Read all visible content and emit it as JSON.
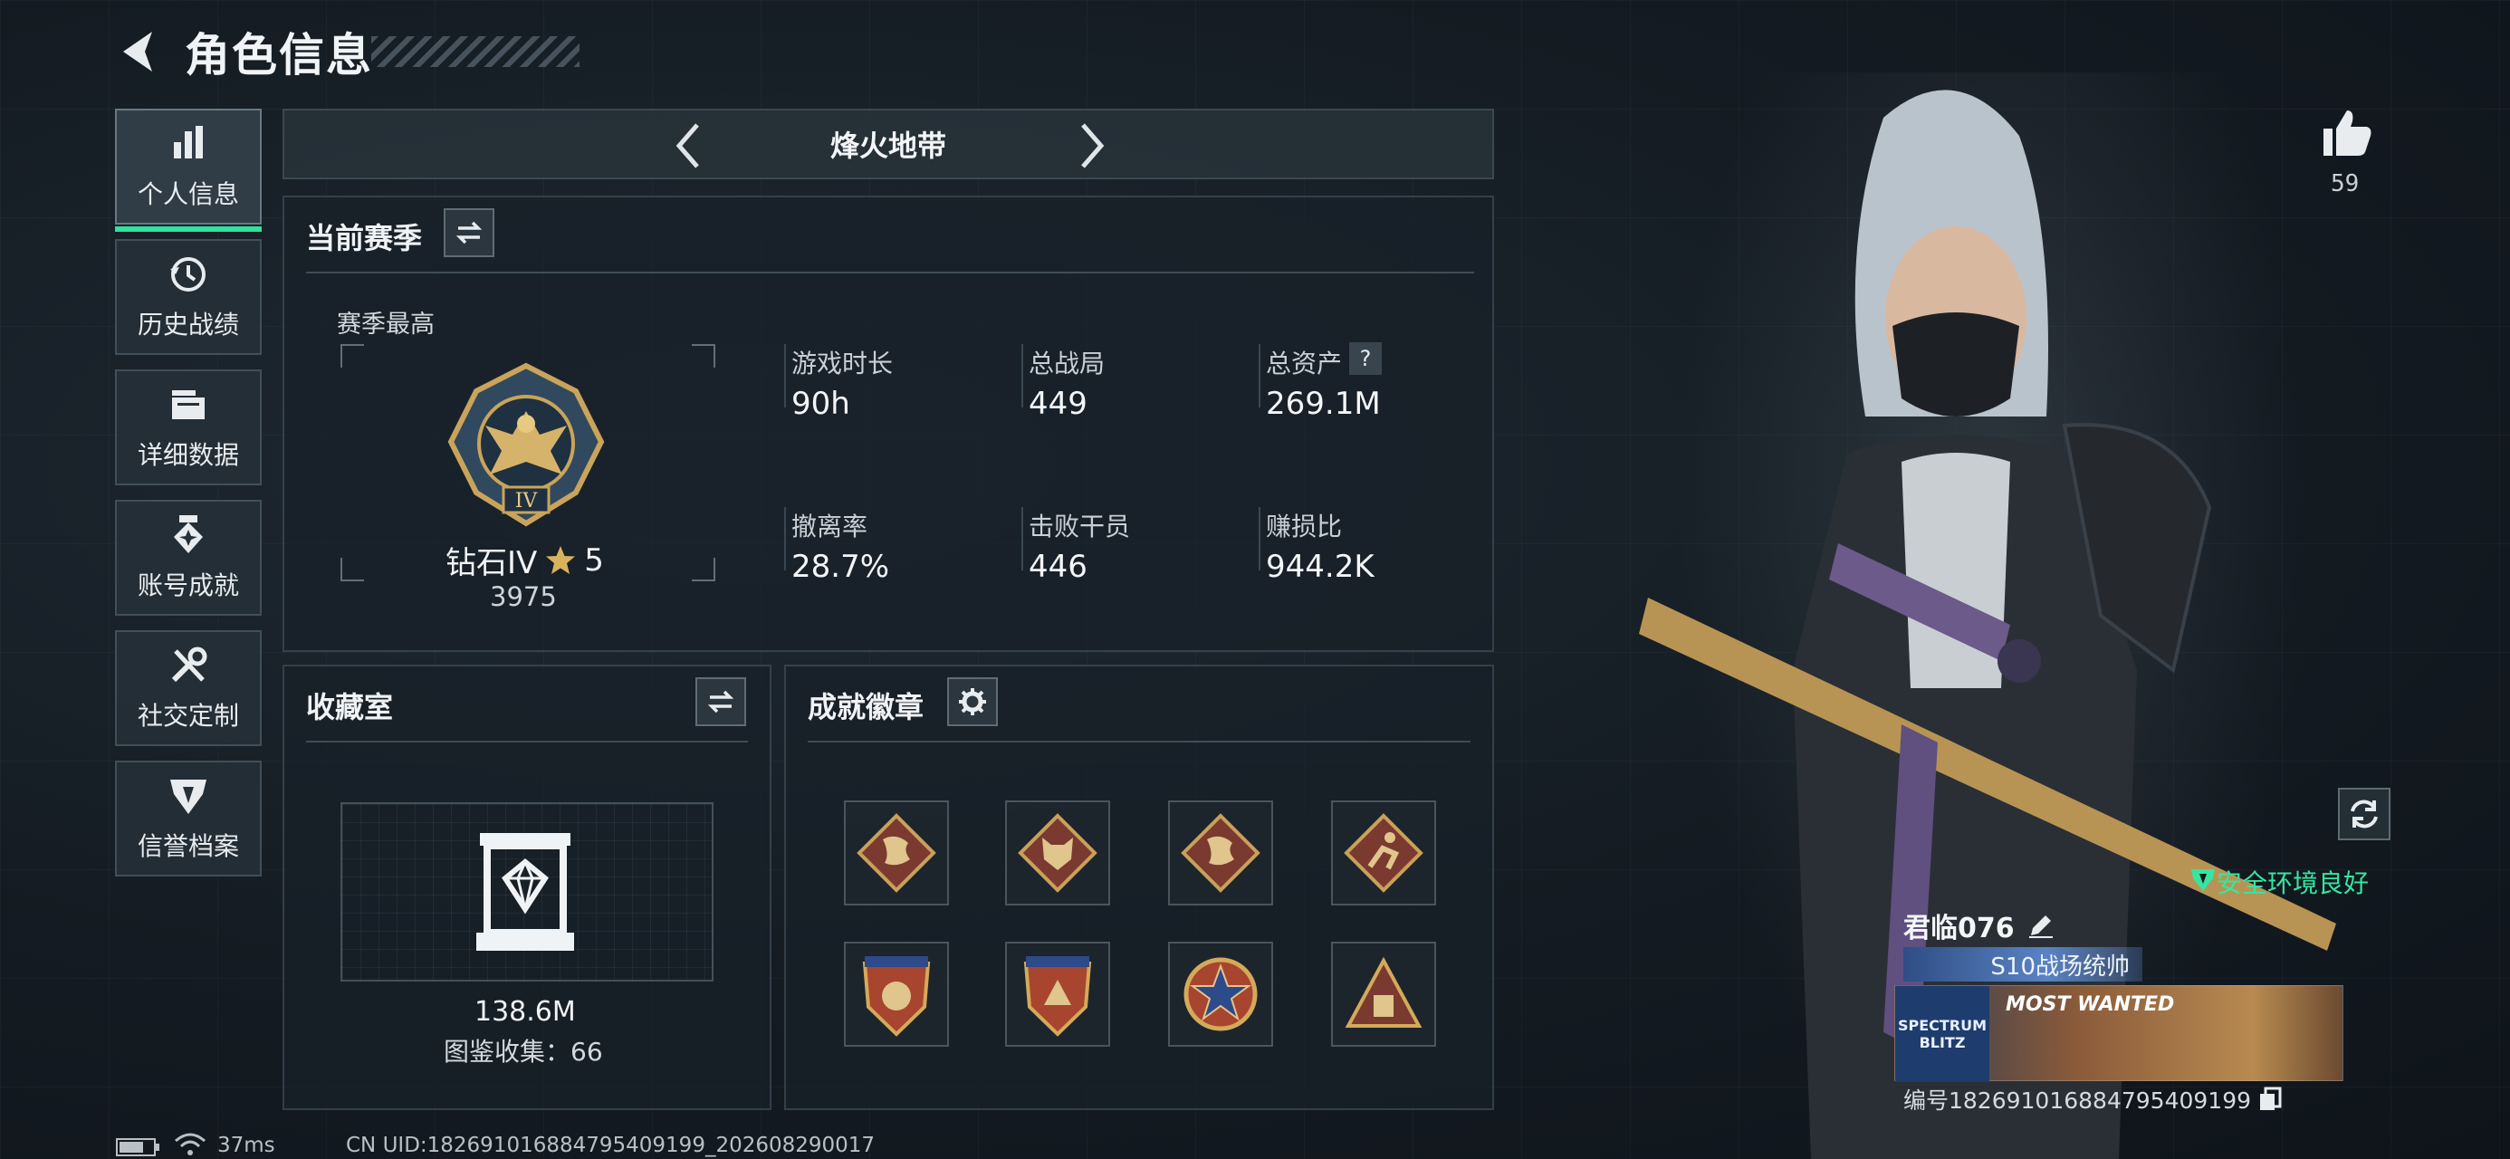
{
  "page": {
    "title": "角色信息"
  },
  "sidebar": {
    "items": [
      {
        "label": "个人信息",
        "icon": "bar-chart-icon",
        "active": true
      },
      {
        "label": "历史战绩",
        "icon": "history-icon",
        "active": false
      },
      {
        "label": "详细数据",
        "icon": "folder-icon",
        "active": false
      },
      {
        "label": "账号成就",
        "icon": "achievement-badge-icon",
        "active": false
      },
      {
        "label": "社交定制",
        "icon": "tools-icon",
        "active": false
      },
      {
        "label": "信誉档案",
        "icon": "shield-icon",
        "active": false
      }
    ]
  },
  "mode": {
    "title": "烽火地带"
  },
  "season": {
    "title": "当前赛季",
    "highest_label": "赛季最高",
    "rank_name": "钻石IV",
    "rank_stars": "5",
    "rank_score": "3975",
    "rank_emblem_numeral": "IV",
    "stats": [
      {
        "label": "游戏时长",
        "value": "90h"
      },
      {
        "label": "总战局",
        "value": "449"
      },
      {
        "label": "总资产",
        "value": "269.1M",
        "help": "?"
      },
      {
        "label": "撤离率",
        "value": "28.7%"
      },
      {
        "label": "击败干员",
        "value": "446"
      },
      {
        "label": "赚损比",
        "value": "944.2K"
      }
    ]
  },
  "collection": {
    "title": "收藏室",
    "value": "138.6M",
    "catalog_label": "图鉴收集：66"
  },
  "badges": {
    "title": "成就徽章",
    "items": [
      "dragon-badge-icon",
      "wolf-badge-icon",
      "dragon-badge-icon",
      "runner-badge-icon",
      "shield-badge-icon",
      "shield-badge-icon",
      "star-medal-icon",
      "pyramid-badge-icon"
    ]
  },
  "profile": {
    "like_count": "59",
    "status": "安全环境良好",
    "name": "君临076",
    "title_banner": "S10战场统帅",
    "card_left": "SPECTRUM BLITZ",
    "card_right": "MOST WANTED",
    "uid": "编号1826910168847954091​99"
  },
  "footer": {
    "ping": "37ms",
    "uid": "CN UID:182691016884795409199_202608290017"
  },
  "colors": {
    "accent": "#2ee59d",
    "safe": "#35e6a0",
    "gold": "#c9a45a"
  }
}
